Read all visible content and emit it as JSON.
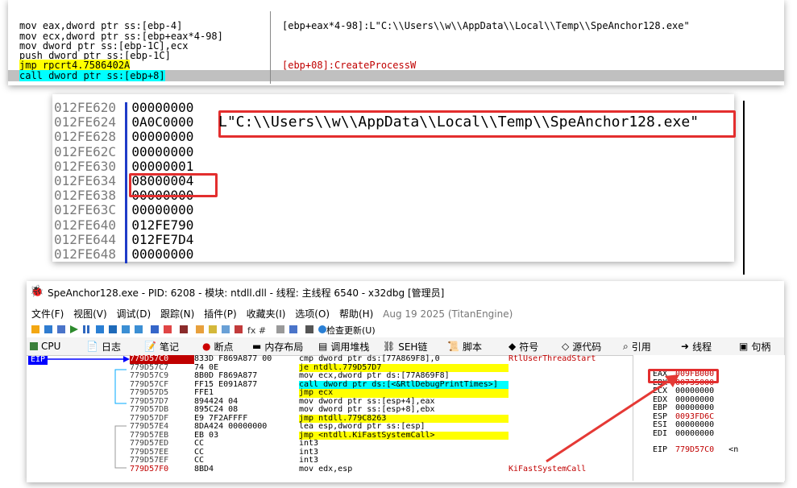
{
  "panel1": {
    "lines": [
      "mov eax,dword ptr ss:[ebp-4]",
      "mov ecx,dword ptr ss:[ebp+eax*4-98]",
      "mov dword ptr ss:[ebp-1C],ecx",
      "push dword ptr ss:[ebp-1C]",
      "jmp rpcrt4.7586402A",
      "call dword ptr ss:[ebp+8]"
    ],
    "comment1": "[ebp+eax*4-98]:L\"C:\\\\Users\\\\w\\\\AppData\\\\Local\\\\Temp\\\\SpeAnchor128.exe\"",
    "comment2": "[ebp+08]:CreateProcessW"
  },
  "panel2": {
    "rows": [
      {
        "addr": "012FE620",
        "val": "00000000"
      },
      {
        "addr": "012FE624",
        "val": "0A0C0000"
      },
      {
        "addr": "012FE628",
        "val": "00000000"
      },
      {
        "addr": "012FE62C",
        "val": "00000000"
      },
      {
        "addr": "012FE630",
        "val": "00000001"
      },
      {
        "addr": "012FE634",
        "val": "08000004"
      },
      {
        "addr": "012FE638",
        "val": "00000000"
      },
      {
        "addr": "012FE63C",
        "val": "00000000"
      },
      {
        "addr": "012FE640",
        "val": "012FE790"
      },
      {
        "addr": "012FE644",
        "val": "012FE7D4"
      },
      {
        "addr": "012FE648",
        "val": "00000000"
      }
    ],
    "string": "L\"C:\\\\Users\\\\w\\\\AppData\\\\Local\\\\Temp\\\\SpeAnchor128.exe\""
  },
  "panel3": {
    "title": "SpeAnchor128.exe - PID: 6208 - 模块: ntdll.dll - 线程: 主线程 6540 - x32dbg [管理员]",
    "menu": [
      "文件(F)",
      "视图(V)",
      "调试(D)",
      "跟踪(N)",
      "插件(P)",
      "收藏夹(I)",
      "选项(O)",
      "帮助(H)"
    ],
    "menu_date": "Aug 19 2025 (TitanEngine)",
    "toolbar_update": "检查更新(U)",
    "tabs": [
      {
        "label": "CPU"
      },
      {
        "label": "日志"
      },
      {
        "label": "笔记"
      },
      {
        "label": "断点"
      },
      {
        "label": "内存布局"
      },
      {
        "label": "调用堆栈"
      },
      {
        "label": "SEH链"
      },
      {
        "label": "脚本"
      },
      {
        "label": "符号"
      },
      {
        "label": "源代码"
      },
      {
        "label": "引用"
      },
      {
        "label": "线程"
      },
      {
        "label": "句柄"
      }
    ],
    "eip_label": "EIP",
    "disasm": [
      {
        "addr": "779D57C0",
        "bytes": "833D F869A877 00",
        "asm": "cmp dword ptr ds:[77A869F8],0",
        "cmt": "RtlUserThreadStart"
      },
      {
        "addr": "779D57C7",
        "bytes": "74 0E",
        "asm": "je ntdll.779D57D7",
        "cmt": ""
      },
      {
        "addr": "779D57C9",
        "bytes": "8B0D F869A877",
        "asm": "mov ecx,dword ptr ds:[77A869F8]",
        "cmt": ""
      },
      {
        "addr": "779D57CF",
        "bytes": "FF15 E091A877",
        "asm": "call dword ptr ds:[<&RtlDebugPrintTimes>]",
        "cmt": ""
      },
      {
        "addr": "779D57D5",
        "bytes": "FFE1",
        "asm": "jmp ecx",
        "cmt": ""
      },
      {
        "addr": "779D57D7",
        "bytes": "894424 04",
        "asm": "mov dword ptr ss:[esp+4],eax",
        "cmt": ""
      },
      {
        "addr": "779D57DB",
        "bytes": "895C24 08",
        "asm": "mov dword ptr ss:[esp+8],ebx",
        "cmt": ""
      },
      {
        "addr": "779D57DF",
        "bytes": "E9 7F2AFFFF",
        "asm": "jmp ntdll.779C8263",
        "cmt": ""
      },
      {
        "addr": "779D57E4",
        "bytes": "8DA424 00000000",
        "asm": "lea esp,dword ptr ss:[esp]",
        "cmt": ""
      },
      {
        "addr": "779D57EB",
        "bytes": "EB 03",
        "asm": "jmp <ntdll.KiFastSystemCall>",
        "cmt": ""
      },
      {
        "addr": "779D57ED",
        "bytes": "CC",
        "asm": "int3",
        "cmt": ""
      },
      {
        "addr": "779D57EE",
        "bytes": "CC",
        "asm": "int3",
        "cmt": ""
      },
      {
        "addr": "779D57EF",
        "bytes": "CC",
        "asm": "int3",
        "cmt": ""
      },
      {
        "addr": "779D57F0",
        "bytes": "8BD4",
        "asm": "mov edx,esp",
        "cmt": "KiFastSystemCall"
      }
    ],
    "regs": [
      {
        "name": "EAX",
        "val": "009FB000"
      },
      {
        "name": "EBX",
        "val": "00735000"
      },
      {
        "name": "ECX",
        "val": "00000000"
      },
      {
        "name": "EDX",
        "val": "00000000"
      },
      {
        "name": "EBP",
        "val": "00000000"
      },
      {
        "name": "ESP",
        "val": "0093FD6C"
      },
      {
        "name": "ESI",
        "val": "00000000"
      },
      {
        "name": "EDI",
        "val": "00000000"
      }
    ],
    "eip_reg": {
      "name": "EIP",
      "val": "779D57C0"
    },
    "eip_reg_extra": "<n"
  }
}
